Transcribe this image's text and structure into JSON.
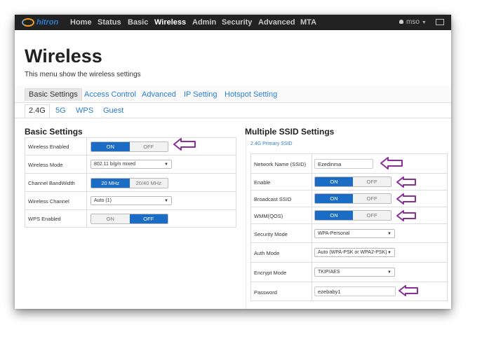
{
  "nav": {
    "logo": "hitron",
    "items": [
      "Home",
      "Status",
      "Basic",
      "Wireless",
      "Admin",
      "Security",
      "Advanced",
      "MTA"
    ],
    "user": "mso"
  },
  "page": {
    "title": "Wireless",
    "subtitle": "This menu show the wireless settings"
  },
  "tabs": [
    "Basic Settings",
    "Access Control",
    "Advanced",
    "IP Setting",
    "Hotspot Setting"
  ],
  "bands": [
    "2.4G",
    "5G",
    "WPS",
    "Guest"
  ],
  "basic": {
    "title": "Basic Settings",
    "wireless_enabled": {
      "label": "Wireless Enabled",
      "on": "ON",
      "off": "OFF"
    },
    "wireless_mode": {
      "label": "Wireless Mode",
      "value": "802.11 b/g/n mixed"
    },
    "bandwidth": {
      "label": "Channel BandWidth",
      "opt1": "20 MHz",
      "opt2": "20/40 MHz"
    },
    "channel": {
      "label": "Wireless Channel",
      "value": "Auto (1)"
    },
    "wps": {
      "label": "WPS Enabled",
      "on": "ON",
      "off": "OFF"
    }
  },
  "ssid": {
    "title": "Multiple SSID Settings",
    "link": "2.4G Primary SSID",
    "network_name": {
      "label": "Network Name (SSID)",
      "value": "Ezedinma"
    },
    "enable": {
      "label": "Enable",
      "on": "ON",
      "off": "OFF"
    },
    "broadcast": {
      "label": "Broadcast SSID",
      "on": "ON",
      "off": "OFF"
    },
    "wmm": {
      "label": "WMM(QOS)",
      "on": "ON",
      "off": "OFF"
    },
    "security_mode": {
      "label": "Security Mode",
      "value": "WPA-Personal"
    },
    "auth_mode": {
      "label": "Auth Mode",
      "value": "Auto (WPA-PSK or WPA2-PSK)"
    },
    "encrypt_mode": {
      "label": "Encrypt Mode",
      "value": "TKIP/AES"
    },
    "password": {
      "label": "Password",
      "value": "ezebaby1"
    }
  },
  "icons": {
    "user": "user-icon",
    "monitor": "monitor-icon",
    "annotation": "arrow-left-icon"
  },
  "colors": {
    "accent": "#1a6cc4",
    "annotation": "#8b2e9a",
    "navbar": "#222222"
  }
}
